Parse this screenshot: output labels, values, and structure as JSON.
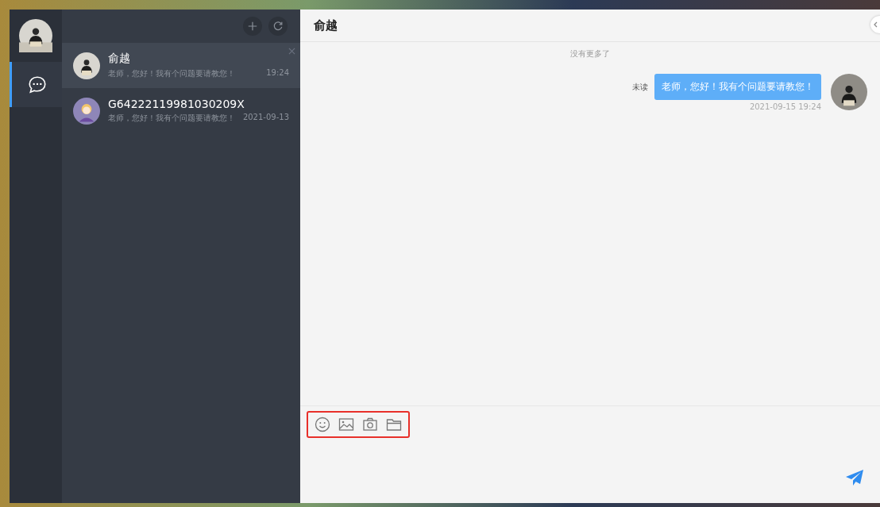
{
  "nav": {
    "items": [
      {
        "kind": "chat",
        "selected": true
      }
    ]
  },
  "conversation_list": {
    "items": [
      {
        "name": "俞越",
        "preview": "老师，您好！我有个问题要请教您！",
        "time": "19:24",
        "selected": true
      },
      {
        "name": "G64222119981030209X",
        "preview": "老师，您好！我有个问题要请教您！",
        "time": "2021-09-13",
        "selected": false
      }
    ]
  },
  "chat": {
    "title": "俞越",
    "history_note": "没有更多了",
    "messages": [
      {
        "text": "老师，您好！我有个问题要请教您！",
        "status": "未读",
        "time": "2021-09-15 19:24"
      }
    ]
  }
}
